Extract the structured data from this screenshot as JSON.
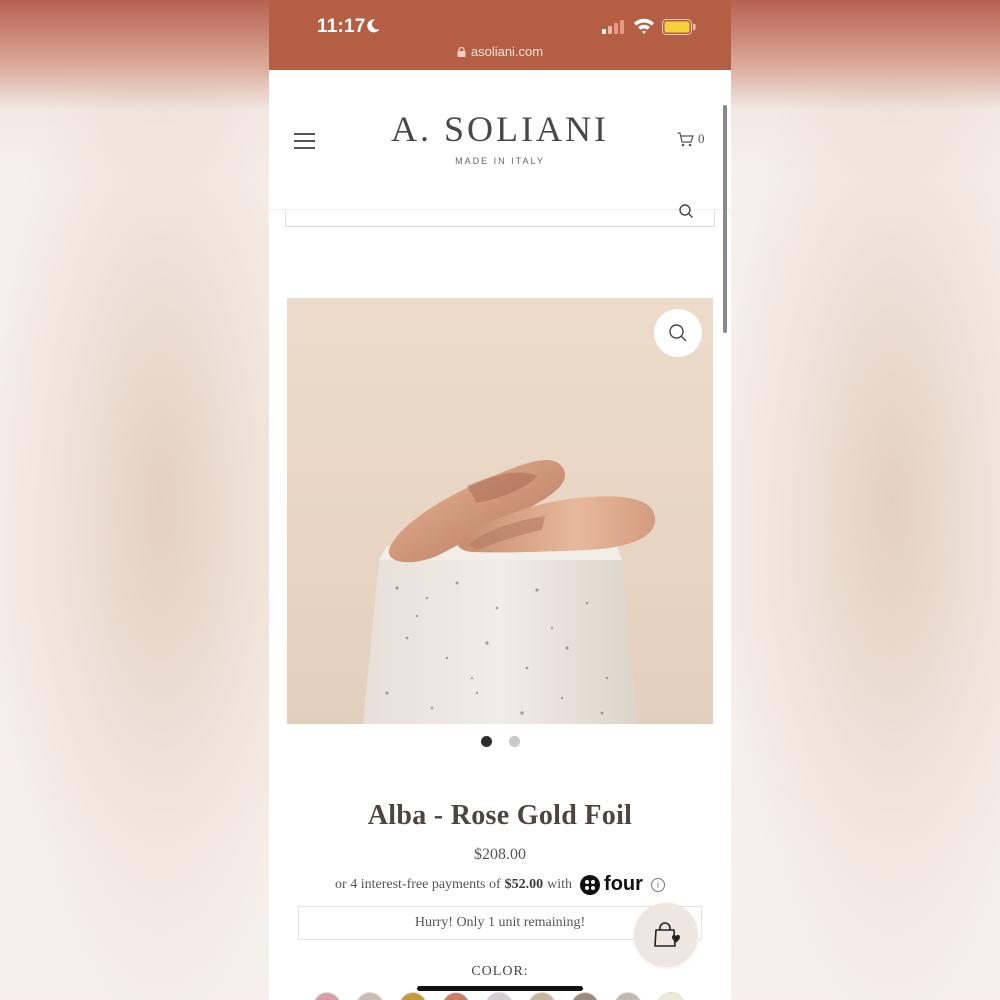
{
  "status_bar": {
    "time": "11:17",
    "url": "asoliani.com"
  },
  "header": {
    "logo": "A. SOLIANI",
    "tagline": "MADE IN ITALY",
    "cart_count": "0"
  },
  "product": {
    "title": "Alba - Rose Gold Foil",
    "price": "$208.00",
    "installments_prefix": "or 4 interest-free payments of",
    "installment_amount": "$52.00",
    "installments_with": "with",
    "provider": "four",
    "info_glyph": "i",
    "stock_notice": "Hurry! Only 1 unit remaining!",
    "color_label": "COLOR:",
    "image_count": 2,
    "active_image": 1
  },
  "colors": {
    "status_bar": "#b45f44",
    "accent_text": "#4c4541",
    "swatches": [
      "#d7a0a5",
      "#cbbcb2",
      "#c49a3b",
      "#c97f66",
      "#d9cbd3",
      "#c8b79c",
      "#9e8a78",
      "#c4b9ab",
      "#f0ebd7"
    ]
  },
  "icons": {
    "menu": "menu-icon",
    "cart": "cart-icon",
    "search": "search-icon",
    "zoom": "zoom-icon",
    "bag": "shopping-bag-heart-icon",
    "info": "info-icon"
  }
}
